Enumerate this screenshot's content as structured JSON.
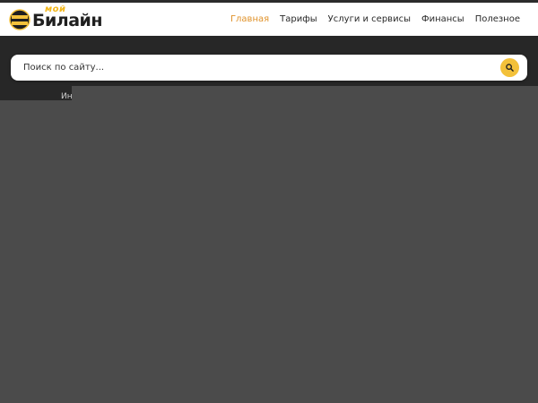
{
  "brand": {
    "logo_sup": "мой",
    "logo_main": "Билайн",
    "accent_color": "#f3c13a",
    "active_nav_color": "#e0922a"
  },
  "nav": {
    "items": [
      {
        "label": "Главная",
        "active": true
      },
      {
        "label": "Тарифы",
        "active": false
      },
      {
        "label": "Услуги и сервисы",
        "active": false
      },
      {
        "label": "Финансы",
        "active": false
      },
      {
        "label": "Полезное",
        "active": false
      }
    ]
  },
  "search": {
    "placeholder": "Поиск по сайту...",
    "icon": "search-icon"
  },
  "band": {
    "label": "Ин"
  }
}
